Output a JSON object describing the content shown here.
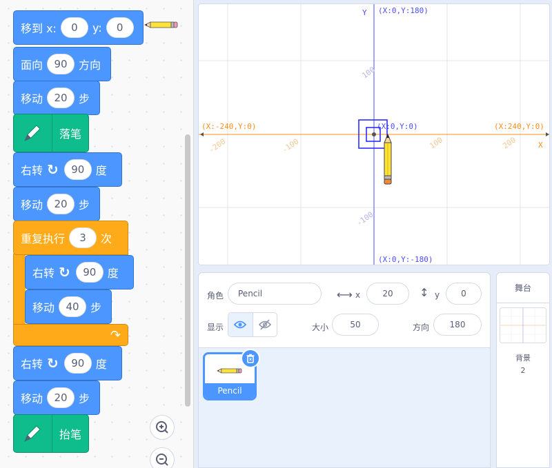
{
  "blocks": {
    "goto": {
      "label_prefix": "移到 x:",
      "x": "0",
      "y_label": "y:",
      "y": "0"
    },
    "point": {
      "label": "面向",
      "value": "90",
      "suffix": "方向"
    },
    "move1": {
      "label": "移动",
      "value": "20",
      "suffix": "步"
    },
    "pen_down": {
      "label": "落笔"
    },
    "turn1": {
      "label": "右转",
      "icon": "rotate-right-icon",
      "value": "90",
      "suffix": "度"
    },
    "move2": {
      "label": "移动",
      "value": "20",
      "suffix": "步"
    },
    "repeat": {
      "label": "重复执行",
      "value": "3",
      "suffix": "次"
    },
    "turn2": {
      "label": "右转",
      "icon": "rotate-right-icon",
      "value": "90",
      "suffix": "度"
    },
    "move3": {
      "label": "移动",
      "value": "40",
      "suffix": "步"
    },
    "turn3": {
      "label": "右转",
      "icon": "rotate-right-icon",
      "value": "90",
      "suffix": "度"
    },
    "move4": {
      "label": "移动",
      "value": "20",
      "suffix": "步"
    },
    "pen_up": {
      "label": "抬笔"
    }
  },
  "stage": {
    "axis_y_label": "Y",
    "axis_x_label": "X",
    "top": "(X:0,Y:180)",
    "bottom": "(X:0,Y:-180)",
    "left": "(X:-240,Y:0)",
    "right": "(X:240,Y:0)",
    "origin": "(X:0,Y:0)",
    "tick_y_pos": "100",
    "tick_y_neg": "-100",
    "tick_x_neg200": "-200",
    "tick_x_neg100": "-100",
    "tick_x_pos100": "100",
    "tick_x_pos200": "200",
    "colors": {
      "x_axis": "#ff8c1a",
      "y_axis": "#4c4cff",
      "x_text": "#ff8c1a",
      "y_text": "#4c4cff"
    }
  },
  "sprite_info": {
    "sprite_label": "角色",
    "sprite_name": "Pencil",
    "x_label": "x",
    "x_value": "20",
    "y_label": "y",
    "y_value": "0",
    "show_label": "显示",
    "size_label": "大小",
    "size_value": "50",
    "direction_label": "方向",
    "direction_value": "180"
  },
  "sprite_list": {
    "items": [
      {
        "name": "Pencil"
      }
    ]
  },
  "stage_panel": {
    "title": "舞台",
    "backdrop_label": "背景",
    "backdrop_count": "2"
  },
  "accent": "#4c97ff"
}
